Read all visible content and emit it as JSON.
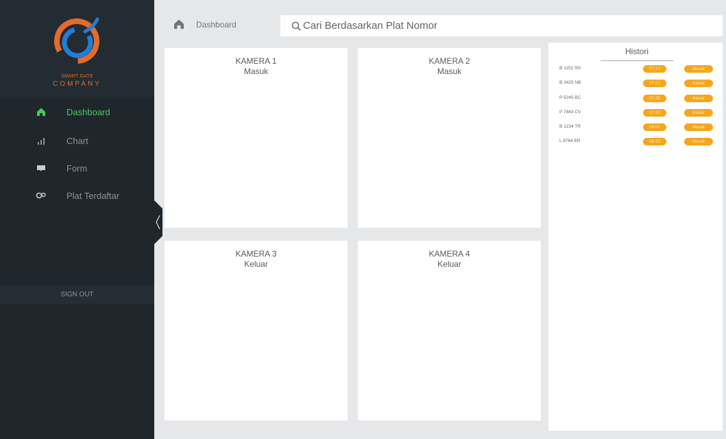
{
  "brand": {
    "sub": "SMART GATE",
    "main": "COMPANY",
    "colors": {
      "orange": "#e46b2c",
      "blue": "#1f7fd6"
    }
  },
  "nav": [
    {
      "label": "Dashboard",
      "icon": "home-icon",
      "active": true
    },
    {
      "label": "Chart",
      "icon": "bar-chart-icon",
      "active": false
    },
    {
      "label": "Form",
      "icon": "comment-icon",
      "active": false
    },
    {
      "label": "Plat Terdaftar",
      "icon": "link-icon",
      "active": false
    }
  ],
  "signout": "SIGN OUT",
  "header": {
    "breadcrumb": "Dashboard",
    "search_placeholder": "Cari Berdasarkan Plat Nomor"
  },
  "cameras": [
    {
      "title": "KAMERA 1",
      "status": "Masuk"
    },
    {
      "title": "KAMERA 2",
      "status": "Masuk"
    },
    {
      "title": "KAMERA 3",
      "status": "Keluar"
    },
    {
      "title": "KAMERA 4",
      "status": "Keluar"
    }
  ],
  "histori": {
    "title": "Histori",
    "rows": [
      {
        "plate": "B 1152 SN",
        "time": "07.12",
        "status": "Masuk"
      },
      {
        "plate": "B 3425 NB",
        "time": "07.21",
        "status": "Keluar"
      },
      {
        "plate": "P 5245 BC",
        "time": "07.35",
        "status": "Keluar"
      },
      {
        "plate": "P 7843 CV",
        "time": "07.50",
        "status": "Keluar"
      },
      {
        "plate": "B 1234 TR",
        "time": "08.01",
        "status": "Masuk"
      },
      {
        "plate": "L 8764 ER",
        "time": "08.23",
        "status": "Masuk"
      }
    ]
  },
  "colors": {
    "sidebar": "#1f272d",
    "active": "#4cc85a",
    "badge": "#f6a61d",
    "background": "#e6e7e9"
  }
}
